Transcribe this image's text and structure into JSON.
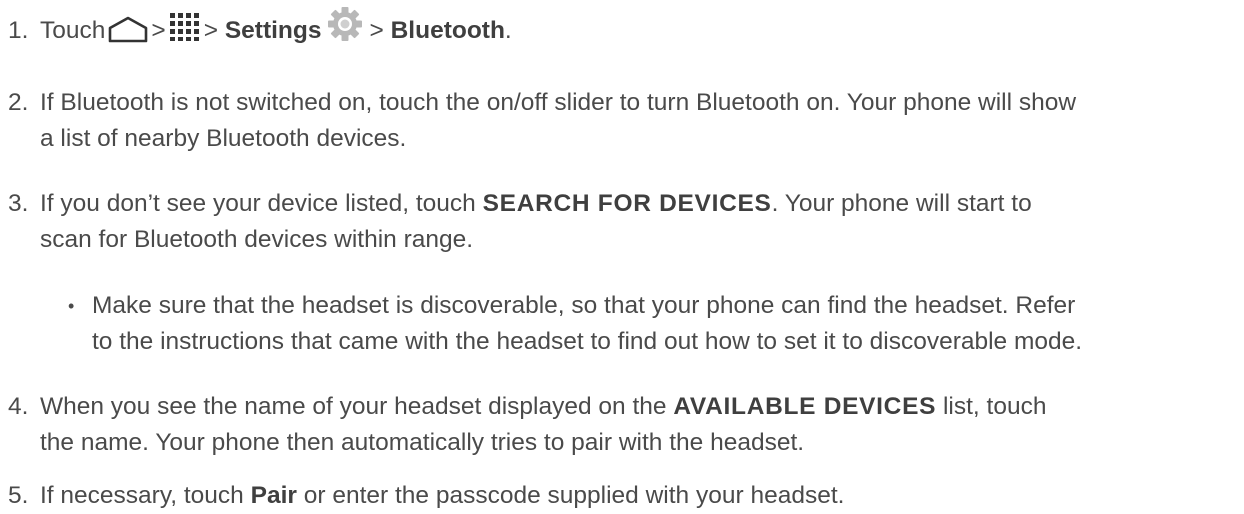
{
  "steps": [
    {
      "number": "1.",
      "touch": "Touch",
      "sep1": ">",
      "sep2": ">",
      "settings": "Settings",
      "sep3": ">",
      "bluetooth": "Bluetooth",
      "end": ".",
      "icons": [
        "home-icon",
        "apps-icon",
        "gear-icon"
      ]
    },
    {
      "number": "2.",
      "line1": "If Bluetooth is not switched on, touch the on/off slider to turn Bluetooth on. Your phone will show",
      "line2": "a list of nearby Bluetooth devices."
    },
    {
      "number": "3.",
      "line1_pre": "If you don’t see your device listed, touch ",
      "line1_ui": "SEARCH FOR DEVICES",
      "line1_post": ". Your phone will start to",
      "line2": "scan for Bluetooth devices within range."
    },
    {
      "bullet": "•",
      "line1": "Make sure that the headset is discoverable, so that your phone can find the headset. Refer",
      "line2": "to the instructions that came with the headset to find out how to set it to discoverable mode."
    },
    {
      "number": "4.",
      "line1_pre": "When you see the name of your headset displayed on the ",
      "line1_ui": "AVAILABLE DEVICES",
      "line1_post": " list, touch",
      "line2": "the name. Your phone then automatically tries to pair with the headset."
    },
    {
      "number": "5.",
      "line1_pre": "If necessary, touch ",
      "line1_bold": "Pair",
      "line1_post": " or enter the passcode supplied with your headset."
    }
  ],
  "colors": {
    "text": "#4a4a4a",
    "icon": "#333333",
    "gear": "#b8b8b8"
  }
}
